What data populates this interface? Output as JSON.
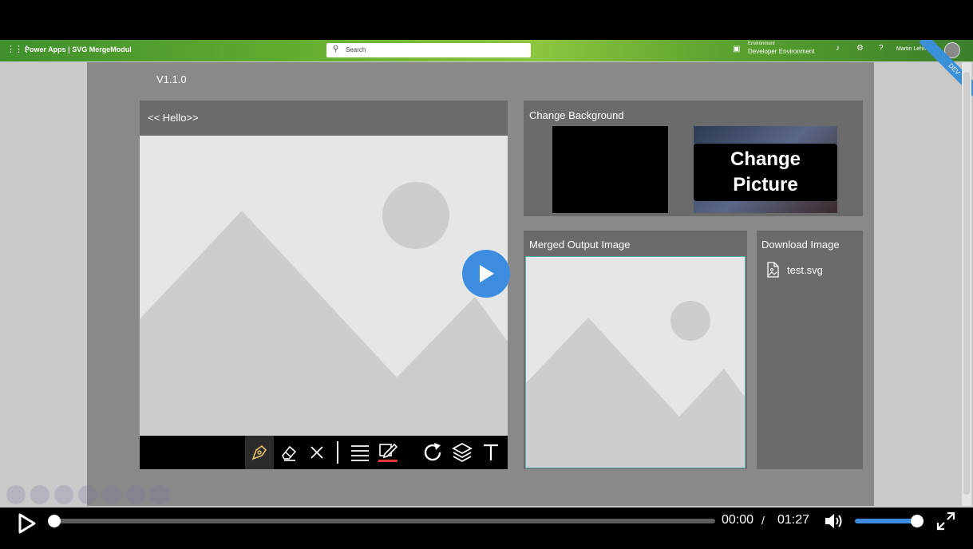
{
  "header": {
    "app_title": "Power Apps | SVG MergeModul",
    "search_placeholder": "Search",
    "environment_label": "Environment",
    "environment_value": "Developer Environment",
    "user_name": "Martin Lehmann",
    "ribbon": "DEV"
  },
  "app": {
    "version": "V1.1.0",
    "left_panel_title": "<< Hello>>",
    "change_background_title": "Change Background",
    "change_picture_label": "Change\nPicture",
    "merged_title": "Merged Output Image",
    "download_title": "Download Image",
    "download_file": "test.svg"
  },
  "toolbar": {
    "tools": [
      "pen-icon",
      "eraser-icon",
      "close-icon",
      "separator",
      "lines-icon",
      "edit-color-icon",
      "rotate-icon",
      "layers-icon",
      "text-icon"
    ],
    "accent_color": "#e53935"
  },
  "player": {
    "current_time": "00:00",
    "separator": "/",
    "total_time": "01:27",
    "progress": 0.0,
    "volume": 0.9,
    "accent_color": "#3c8de0"
  }
}
